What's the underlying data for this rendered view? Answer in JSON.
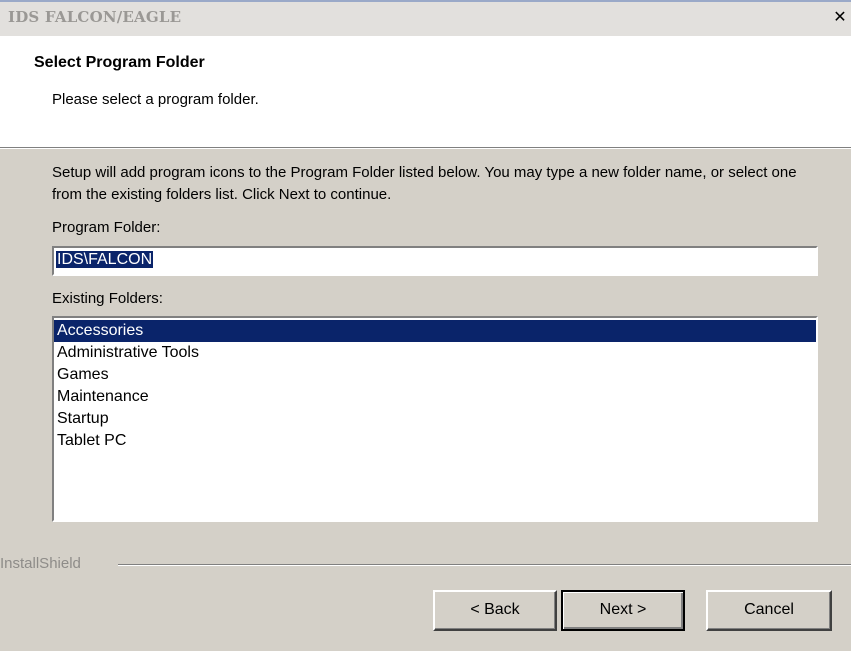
{
  "window": {
    "title": "IDS FALCON/EAGLE",
    "close_glyph": "✕"
  },
  "header": {
    "title": "Select Program Folder",
    "subtitle": "Please select a program folder."
  },
  "body": {
    "description": "Setup will add program icons to the Program Folder listed below.  You may type a new folder name, or select one from the existing folders list.  Click Next to continue.",
    "program_folder_label": "Program Folder:",
    "program_folder_value": "IDS\\FALCON",
    "existing_folders_label": "Existing Folders:",
    "existing_folders": [
      {
        "label": "Accessories",
        "selected": true
      },
      {
        "label": "Administrative Tools",
        "selected": false
      },
      {
        "label": "Games",
        "selected": false
      },
      {
        "label": "Maintenance",
        "selected": false
      },
      {
        "label": "Startup",
        "selected": false
      },
      {
        "label": "Tablet PC",
        "selected": false
      }
    ]
  },
  "footer": {
    "brand": "InstallShield",
    "back_label": "< Back",
    "next_label": "Next >",
    "cancel_label": "Cancel"
  },
  "colors": {
    "selection": "#0a246a",
    "dialog_bg": "#d4d0c8"
  }
}
